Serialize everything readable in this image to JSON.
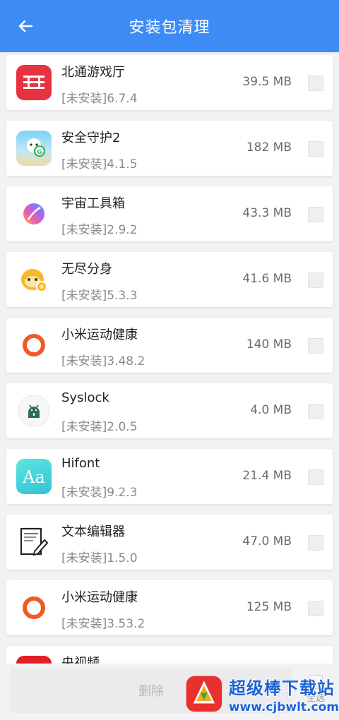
{
  "header": {
    "title": "安装包清理",
    "back_icon": "arrow-left-icon"
  },
  "apps": [
    {
      "name": "北通游戏厅",
      "version": "[未安装]6.7.4",
      "size": "39.5 MB",
      "icon": "betop-icon"
    },
    {
      "name": "安全守护2",
      "version": "[未安装]4.1.5",
      "size": "182 MB",
      "icon": "guard-icon"
    },
    {
      "name": "宇宙工具箱",
      "version": "[未安装]2.9.2",
      "size": "43.3 MB",
      "icon": "universe-icon"
    },
    {
      "name": "无尽分身",
      "version": "[未安装]5.3.3",
      "size": "41.6 MB",
      "icon": "monkey-icon"
    },
    {
      "name": "小米运动健康",
      "version": "[未安装]3.48.2",
      "size": "140 MB",
      "icon": "mi-fitness-icon"
    },
    {
      "name": "Syslock",
      "version": "[未安装]2.0.5",
      "size": "4.0 MB",
      "icon": "android-lock-icon"
    },
    {
      "name": "Hifont",
      "version": "[未安装]9.2.3",
      "size": "21.4 MB",
      "icon": "hifont-icon"
    },
    {
      "name": "文本编辑器",
      "version": "[未安装]1.5.0",
      "size": "47.0 MB",
      "icon": "text-editor-icon"
    },
    {
      "name": "小米运动健康",
      "version": "[未安装]3.53.2",
      "size": "125 MB",
      "icon": "mi-fitness-icon"
    },
    {
      "name": "央视频",
      "version": "",
      "size": "",
      "icon": "cctv-icon"
    }
  ],
  "footer": {
    "delete_label": "删除",
    "select_all_label": "全选"
  },
  "watermark": {
    "text": "超级棒下载站",
    "url": "www.cjbwlt.com"
  },
  "colors": {
    "header": "#3d8cf5",
    "background": "#f2f2f4"
  }
}
